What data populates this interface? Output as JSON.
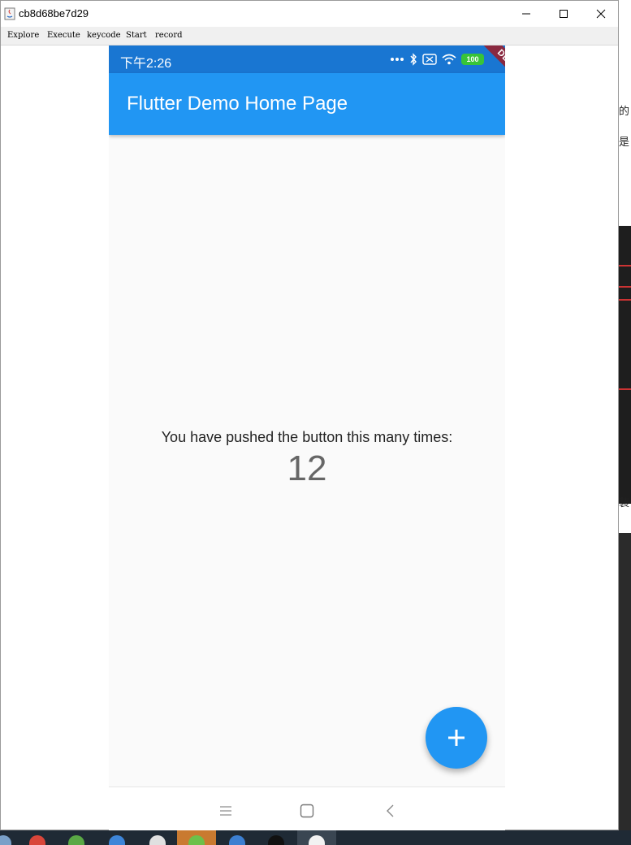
{
  "window": {
    "title": "cb8d68be7d29",
    "menu": [
      "Explore",
      "Execute",
      "keycode",
      "Start",
      "record"
    ],
    "controls": [
      "minimize-icon",
      "maximize-icon",
      "close-icon"
    ]
  },
  "background": {
    "fragment_1": "的",
    "fragment_2": "是",
    "fragment_3": "装"
  },
  "status_bar": {
    "time": "下午2:26",
    "icons": [
      "more-dots-icon",
      "bluetooth-icon",
      "sim-icon",
      "wifi-icon",
      "battery-icon"
    ],
    "battery": "100"
  },
  "app_bar": {
    "title": "Flutter Demo Home Page",
    "debug_banner": "DEBUG"
  },
  "body": {
    "message": "You have pushed the button this many times:",
    "counter": "12"
  },
  "fab": {
    "icon": "plus-icon"
  },
  "nav_bar": {
    "icons": [
      "menu-icon",
      "home-icon",
      "back-icon"
    ]
  },
  "colors": {
    "status_bar": "#1976d2",
    "app_bar": "#2196f3",
    "fab": "#2196f3",
    "debug_banner": "#8a2940",
    "screen_bg": "#fafafa"
  },
  "taskbar": {
    "apps": [
      "chrome-icon",
      "app-green-icon",
      "app-blue-icon",
      "files-icon",
      "wechat-icon",
      "vscode-icon",
      "terminal-icon",
      "java-icon"
    ]
  }
}
